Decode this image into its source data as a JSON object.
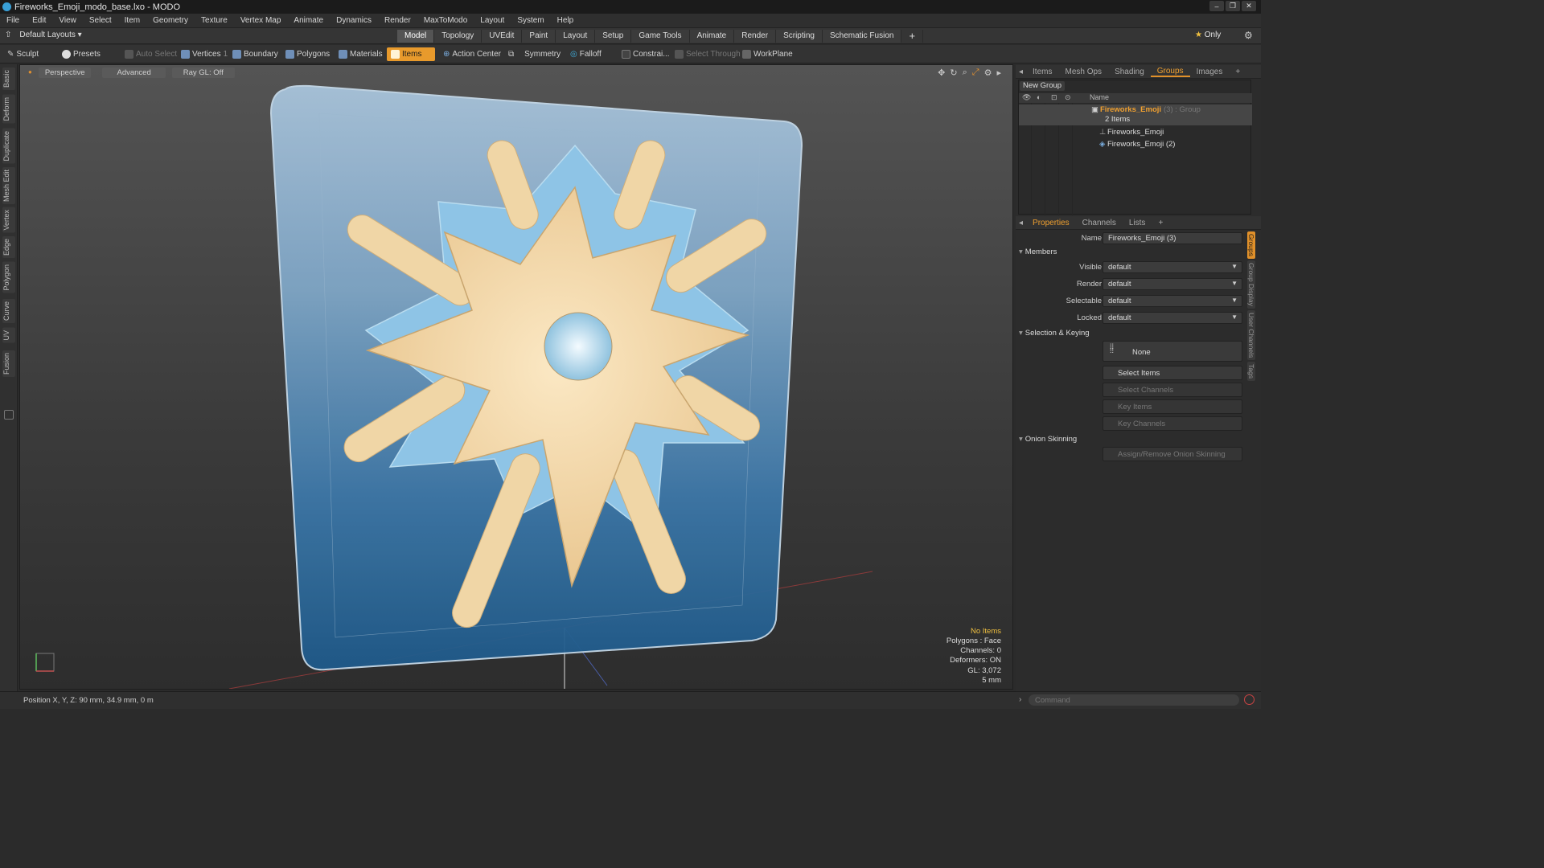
{
  "window": {
    "title": "Fireworks_Emoji_modo_base.lxo - MODO",
    "controls": [
      "–",
      "❐",
      "✕"
    ]
  },
  "menu": [
    "File",
    "Edit",
    "View",
    "Select",
    "Item",
    "Geometry",
    "Texture",
    "Vertex Map",
    "Animate",
    "Dynamics",
    "Render",
    "MaxToModo",
    "Layout",
    "System",
    "Help"
  ],
  "layout_bar": {
    "layouts_label": "Default Layouts",
    "tabs": [
      "Model",
      "Topology",
      "UVEdit",
      "Paint",
      "Layout",
      "Setup",
      "Game Tools",
      "Animate",
      "Render",
      "Scripting",
      "Schematic Fusion"
    ],
    "active_tab": "Model",
    "add_tab": "+",
    "only_label": "Only",
    "star_icon": "★"
  },
  "toolbar": {
    "sculpt": "Sculpt",
    "presets": "Presets",
    "auto_select": "Auto Select",
    "vertices": "Vertices",
    "vertices_count": "1",
    "boundary": "Boundary",
    "polygons": "Polygons",
    "materials": "Materials",
    "items": "Items",
    "action_center": "Action Center",
    "symmetry": "Symmetry",
    "falloff": "Falloff",
    "constraints": "Constrai...",
    "select_through": "Select Through",
    "workplane": "WorkPlane"
  },
  "left_tabs": [
    "Basic",
    "Deform",
    "Duplicate",
    "Mesh Edit",
    "Vertex",
    "Edge",
    "Polygon",
    "Curve",
    "UV",
    "Fusion"
  ],
  "viewport": {
    "buttons": [
      "Perspective",
      "Advanced",
      "Ray GL: Off"
    ],
    "info": {
      "no_items": "No Items",
      "polygons": "Polygons : Face",
      "channels": "Channels: 0",
      "deformers": "Deformers: ON",
      "gl": "GL: 3,072",
      "scale": "5 mm"
    }
  },
  "groups_panel": {
    "tabs": [
      "Items",
      "Mesh Ops",
      "Shading",
      "Groups",
      "Images",
      "+"
    ],
    "active_tab": "Groups",
    "new_group": "New Group",
    "header_name": "Name",
    "rows": {
      "group": {
        "name": "Fireworks_Emoji",
        "suffix": " (3) : Group"
      },
      "count": "2 Items",
      "item1": "Fireworks_Emoji",
      "item2": "Fireworks_Emoji (2)"
    }
  },
  "properties": {
    "tabs": [
      "Properties",
      "Channels",
      "Lists",
      "+"
    ],
    "active_tab": "Properties",
    "name_label": "Name",
    "name_value": "Fireworks_Emoji (3)",
    "members_section": "Members",
    "visible_label": "Visible",
    "visible_value": "default",
    "render_label": "Render",
    "render_value": "default",
    "selectable_label": "Selectable",
    "selectable_value": "default",
    "locked_label": "Locked",
    "locked_value": "default",
    "selection_section": "Selection & Keying",
    "none_label": "None",
    "select_items": "Select Items",
    "select_channels": "Select Channels",
    "key_items": "Key Items",
    "key_channels": "Key Channels",
    "onion_section": "Onion Skinning",
    "onion_button": "Assign/Remove Onion Skinning",
    "side_tabs": [
      "Groups",
      "Group Display",
      "User Channels",
      "Tags"
    ]
  },
  "status": {
    "position": "Position X, Y, Z:  90 mm, 34.9 mm, 0 m",
    "command_placeholder": "Command"
  },
  "colors": {
    "accent_orange": "#e0902a",
    "backplate_blue": "#3a7cae",
    "star_cream": "#f0d6a6"
  }
}
